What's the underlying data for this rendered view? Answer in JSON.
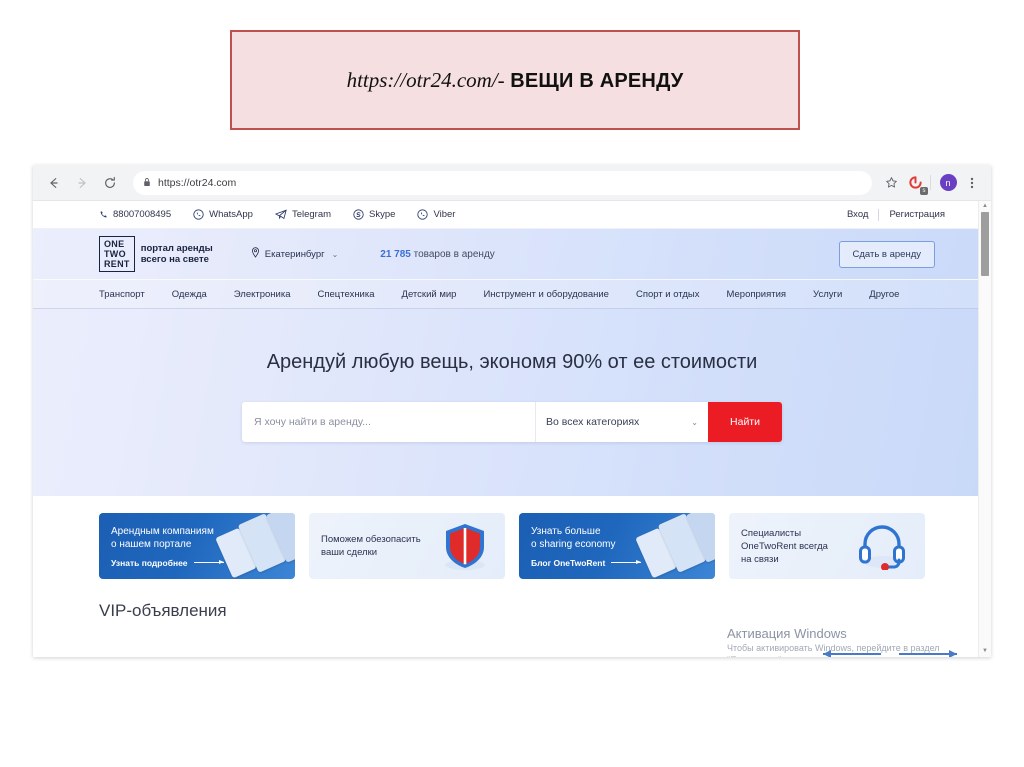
{
  "slide": {
    "banner": {
      "url": "https://otr24.com/-",
      "label": "ВЕЩИ В АРЕНДУ",
      "bg_color": "#f6dfe0",
      "border_color": "#c0504d"
    }
  },
  "browser": {
    "back_icon": "←",
    "forward_icon": "→",
    "reload_icon": "⟳",
    "lock_icon": "🔒",
    "url": "https://otr24.com",
    "bookmark_icon": "☆",
    "extension_icon": "extension-icon",
    "extension_badge": "s",
    "profile_initial": "n",
    "menu_icon": "⋮"
  },
  "site": {
    "topbar": {
      "contacts": [
        {
          "icon": "phone-icon",
          "label": "88007008495"
        },
        {
          "icon": "whatsapp-icon",
          "label": "WhatsApp"
        },
        {
          "icon": "telegram-icon",
          "label": "Telegram"
        },
        {
          "icon": "skype-icon",
          "label": "Skype"
        },
        {
          "icon": "viber-icon",
          "label": "Viber"
        }
      ],
      "login": "Вход",
      "register": "Регистрация"
    },
    "header": {
      "logo_line1": "ONE",
      "logo_line2": "TWO",
      "logo_line3": "RENT",
      "tagline_line1": "портал аренды",
      "tagline_line2": "всего на свете",
      "city": "Екатеринбург",
      "city_chevron": "⌄",
      "goods_count": "21 785",
      "goods_suffix": "товаров в аренду",
      "rent_out_button": "Сдать в аренду"
    },
    "nav": [
      "Транспорт",
      "Одежда",
      "Электроника",
      "Спецтехника",
      "Детский мир",
      "Инструмент и оборудование",
      "Спорт и отдых",
      "Мероприятия",
      "Услуги",
      "Другое"
    ],
    "hero": {
      "title": "Арендуй любую вещь, экономя 90% от ее стоимости",
      "search_placeholder": "Я хочу найти в аренду...",
      "category_value": "Во всех категориях",
      "category_chevron": "⌄",
      "search_button": "Найти",
      "search_button_color": "#ec1c24"
    },
    "promos": [
      {
        "style": "dark",
        "title_line1": "Арендным компаниям",
        "title_line2": "о нашем портале",
        "link": "Узнать подробнее",
        "icon": "devices-illustration"
      },
      {
        "style": "light",
        "title_line1": "Поможем обезопасить",
        "title_line2": "ваши сделки",
        "link": "",
        "icon": "shield-icon"
      },
      {
        "style": "dark",
        "title_line1": "Узнать больше",
        "title_line2": "o sharing economy",
        "link": "Блог OneTwoRent",
        "icon": "devices-illustration"
      },
      {
        "style": "light",
        "title_line1": "Специалисты",
        "title_line2": "OneTwoRent всегда",
        "title_line3": "на связи",
        "link": "",
        "icon": "headset-icon"
      }
    ],
    "vip_title": "VIP-объявления",
    "carousel": {
      "prev_icon": "arrow-left-icon",
      "next_icon": "arrow-right-icon"
    }
  },
  "windows_activation": {
    "title": "Активация Windows",
    "subtitle": "Чтобы активировать Windows, перейдите в раздел \"Параметры\"."
  }
}
